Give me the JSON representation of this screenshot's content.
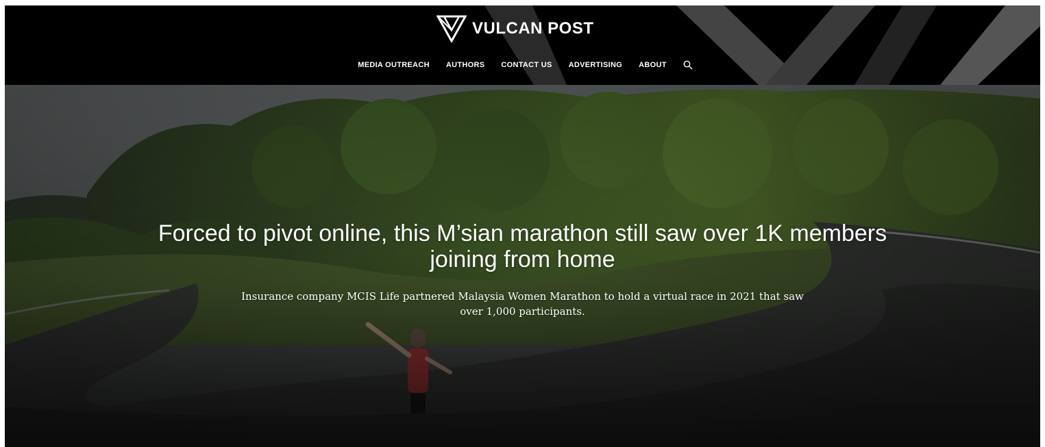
{
  "brand": {
    "name": "VULCAN POST",
    "logo_icon": "vulcan-v-logo-icon"
  },
  "nav": {
    "items": [
      {
        "label": "MEDIA OUTREACH"
      },
      {
        "label": "AUTHORS"
      },
      {
        "label": "CONTACT US"
      },
      {
        "label": "ADVERTISING"
      },
      {
        "label": "ABOUT"
      }
    ],
    "search_icon": "search-icon"
  },
  "hero": {
    "title": "Forced to pivot online, this M’sian marathon still saw over 1K members joining from home",
    "subtitle": "Insurance company MCIS Life partnered Malaysia Women Marathon to hold a virtual race in 2021 that saw over 1,000 participants.",
    "image": "winding-road-runner-photo"
  },
  "colors": {
    "header_bg": "#000000",
    "header_accent": "#3a3a3a",
    "text": "#ffffff"
  }
}
